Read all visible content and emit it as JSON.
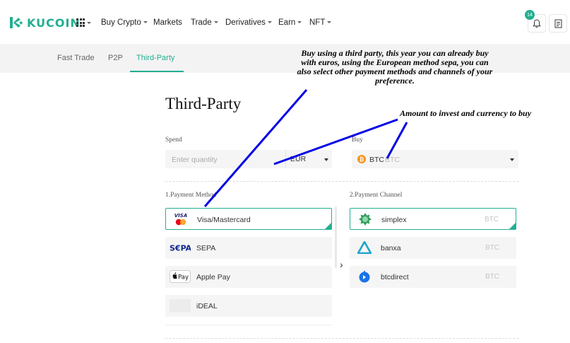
{
  "brand": {
    "name": "KUCOIN",
    "color": "#23af91"
  },
  "nav": {
    "items": [
      {
        "label": "Buy Crypto",
        "dropdown": true
      },
      {
        "label": "Markets",
        "dropdown": false
      },
      {
        "label": "Trade",
        "dropdown": true
      },
      {
        "label": "Derivatives",
        "dropdown": true
      },
      {
        "label": "Earn",
        "dropdown": true
      },
      {
        "label": "NFT",
        "dropdown": true
      }
    ],
    "notification_count": "14"
  },
  "tabs": [
    {
      "label": "Fast Trade",
      "active": false
    },
    {
      "label": "P2P",
      "active": false
    },
    {
      "label": "Third-Party",
      "active": true
    }
  ],
  "page": {
    "title": "Third-Party",
    "spend": {
      "label": "Spend",
      "placeholder": "Enter quantity",
      "currency": "EUR"
    },
    "buy": {
      "label": "Buy",
      "coin": "BTC",
      "coin_placeholder": "BTC"
    },
    "payment_method": {
      "label": "1.Payment Method",
      "items": [
        {
          "label": "Visa/Mastercard",
          "icon": "visa-mastercard-icon",
          "selected": true
        },
        {
          "label": "SEPA",
          "icon": "sepa-icon",
          "selected": false
        },
        {
          "label": "Apple Pay",
          "icon": "apple-pay-icon",
          "selected": false
        },
        {
          "label": "iDEAL",
          "icon": "ideal-icon",
          "selected": false
        }
      ]
    },
    "payment_channel": {
      "label": "2.Payment Channel",
      "items": [
        {
          "label": "simplex",
          "coin": "BTC",
          "icon": "simplex-icon",
          "selected": true
        },
        {
          "label": "banxa",
          "coin": "BTC",
          "icon": "banxa-icon",
          "selected": false
        },
        {
          "label": "btcdirect",
          "coin": "BTC",
          "icon": "btcdirect-icon",
          "selected": false
        }
      ]
    }
  },
  "annotations": {
    "third_party": "Buy using a third party, this year you can already buy with euros, using the European method sepa, you can also select other payment methods and channels of your preference.",
    "amount": "Amount to invest and currency to buy",
    "line_color": "#0000e6"
  }
}
